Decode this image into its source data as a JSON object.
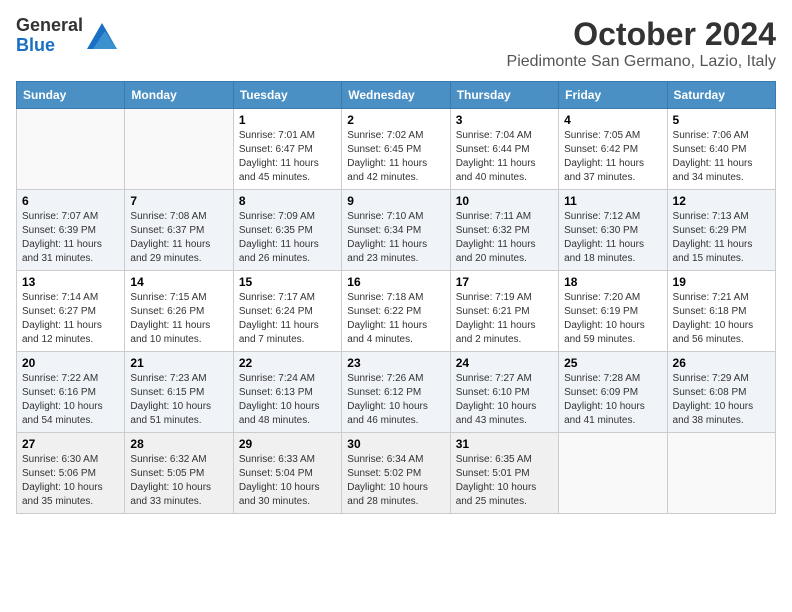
{
  "header": {
    "logo": {
      "general": "General",
      "blue": "Blue"
    },
    "title": "October 2024",
    "location": "Piedimonte San Germano, Lazio, Italy"
  },
  "calendar": {
    "weekdays": [
      "Sunday",
      "Monday",
      "Tuesday",
      "Wednesday",
      "Thursday",
      "Friday",
      "Saturday"
    ],
    "weeks": [
      [
        {
          "day": "",
          "info": ""
        },
        {
          "day": "",
          "info": ""
        },
        {
          "day": "1",
          "sunrise": "Sunrise: 7:01 AM",
          "sunset": "Sunset: 6:47 PM",
          "daylight": "Daylight: 11 hours and 45 minutes."
        },
        {
          "day": "2",
          "sunrise": "Sunrise: 7:02 AM",
          "sunset": "Sunset: 6:45 PM",
          "daylight": "Daylight: 11 hours and 42 minutes."
        },
        {
          "day": "3",
          "sunrise": "Sunrise: 7:04 AM",
          "sunset": "Sunset: 6:44 PM",
          "daylight": "Daylight: 11 hours and 40 minutes."
        },
        {
          "day": "4",
          "sunrise": "Sunrise: 7:05 AM",
          "sunset": "Sunset: 6:42 PM",
          "daylight": "Daylight: 11 hours and 37 minutes."
        },
        {
          "day": "5",
          "sunrise": "Sunrise: 7:06 AM",
          "sunset": "Sunset: 6:40 PM",
          "daylight": "Daylight: 11 hours and 34 minutes."
        }
      ],
      [
        {
          "day": "6",
          "sunrise": "Sunrise: 7:07 AM",
          "sunset": "Sunset: 6:39 PM",
          "daylight": "Daylight: 11 hours and 31 minutes."
        },
        {
          "day": "7",
          "sunrise": "Sunrise: 7:08 AM",
          "sunset": "Sunset: 6:37 PM",
          "daylight": "Daylight: 11 hours and 29 minutes."
        },
        {
          "day": "8",
          "sunrise": "Sunrise: 7:09 AM",
          "sunset": "Sunset: 6:35 PM",
          "daylight": "Daylight: 11 hours and 26 minutes."
        },
        {
          "day": "9",
          "sunrise": "Sunrise: 7:10 AM",
          "sunset": "Sunset: 6:34 PM",
          "daylight": "Daylight: 11 hours and 23 minutes."
        },
        {
          "day": "10",
          "sunrise": "Sunrise: 7:11 AM",
          "sunset": "Sunset: 6:32 PM",
          "daylight": "Daylight: 11 hours and 20 minutes."
        },
        {
          "day": "11",
          "sunrise": "Sunrise: 7:12 AM",
          "sunset": "Sunset: 6:30 PM",
          "daylight": "Daylight: 11 hours and 18 minutes."
        },
        {
          "day": "12",
          "sunrise": "Sunrise: 7:13 AM",
          "sunset": "Sunset: 6:29 PM",
          "daylight": "Daylight: 11 hours and 15 minutes."
        }
      ],
      [
        {
          "day": "13",
          "sunrise": "Sunrise: 7:14 AM",
          "sunset": "Sunset: 6:27 PM",
          "daylight": "Daylight: 11 hours and 12 minutes."
        },
        {
          "day": "14",
          "sunrise": "Sunrise: 7:15 AM",
          "sunset": "Sunset: 6:26 PM",
          "daylight": "Daylight: 11 hours and 10 minutes."
        },
        {
          "day": "15",
          "sunrise": "Sunrise: 7:17 AM",
          "sunset": "Sunset: 6:24 PM",
          "daylight": "Daylight: 11 hours and 7 minutes."
        },
        {
          "day": "16",
          "sunrise": "Sunrise: 7:18 AM",
          "sunset": "Sunset: 6:22 PM",
          "daylight": "Daylight: 11 hours and 4 minutes."
        },
        {
          "day": "17",
          "sunrise": "Sunrise: 7:19 AM",
          "sunset": "Sunset: 6:21 PM",
          "daylight": "Daylight: 11 hours and 2 minutes."
        },
        {
          "day": "18",
          "sunrise": "Sunrise: 7:20 AM",
          "sunset": "Sunset: 6:19 PM",
          "daylight": "Daylight: 10 hours and 59 minutes."
        },
        {
          "day": "19",
          "sunrise": "Sunrise: 7:21 AM",
          "sunset": "Sunset: 6:18 PM",
          "daylight": "Daylight: 10 hours and 56 minutes."
        }
      ],
      [
        {
          "day": "20",
          "sunrise": "Sunrise: 7:22 AM",
          "sunset": "Sunset: 6:16 PM",
          "daylight": "Daylight: 10 hours and 54 minutes."
        },
        {
          "day": "21",
          "sunrise": "Sunrise: 7:23 AM",
          "sunset": "Sunset: 6:15 PM",
          "daylight": "Daylight: 10 hours and 51 minutes."
        },
        {
          "day": "22",
          "sunrise": "Sunrise: 7:24 AM",
          "sunset": "Sunset: 6:13 PM",
          "daylight": "Daylight: 10 hours and 48 minutes."
        },
        {
          "day": "23",
          "sunrise": "Sunrise: 7:26 AM",
          "sunset": "Sunset: 6:12 PM",
          "daylight": "Daylight: 10 hours and 46 minutes."
        },
        {
          "day": "24",
          "sunrise": "Sunrise: 7:27 AM",
          "sunset": "Sunset: 6:10 PM",
          "daylight": "Daylight: 10 hours and 43 minutes."
        },
        {
          "day": "25",
          "sunrise": "Sunrise: 7:28 AM",
          "sunset": "Sunset: 6:09 PM",
          "daylight": "Daylight: 10 hours and 41 minutes."
        },
        {
          "day": "26",
          "sunrise": "Sunrise: 7:29 AM",
          "sunset": "Sunset: 6:08 PM",
          "daylight": "Daylight: 10 hours and 38 minutes."
        }
      ],
      [
        {
          "day": "27",
          "sunrise": "Sunrise: 6:30 AM",
          "sunset": "Sunset: 5:06 PM",
          "daylight": "Daylight: 10 hours and 35 minutes."
        },
        {
          "day": "28",
          "sunrise": "Sunrise: 6:32 AM",
          "sunset": "Sunset: 5:05 PM",
          "daylight": "Daylight: 10 hours and 33 minutes."
        },
        {
          "day": "29",
          "sunrise": "Sunrise: 6:33 AM",
          "sunset": "Sunset: 5:04 PM",
          "daylight": "Daylight: 10 hours and 30 minutes."
        },
        {
          "day": "30",
          "sunrise": "Sunrise: 6:34 AM",
          "sunset": "Sunset: 5:02 PM",
          "daylight": "Daylight: 10 hours and 28 minutes."
        },
        {
          "day": "31",
          "sunrise": "Sunrise: 6:35 AM",
          "sunset": "Sunset: 5:01 PM",
          "daylight": "Daylight: 10 hours and 25 minutes."
        },
        {
          "day": "",
          "info": ""
        },
        {
          "day": "",
          "info": ""
        }
      ]
    ]
  }
}
